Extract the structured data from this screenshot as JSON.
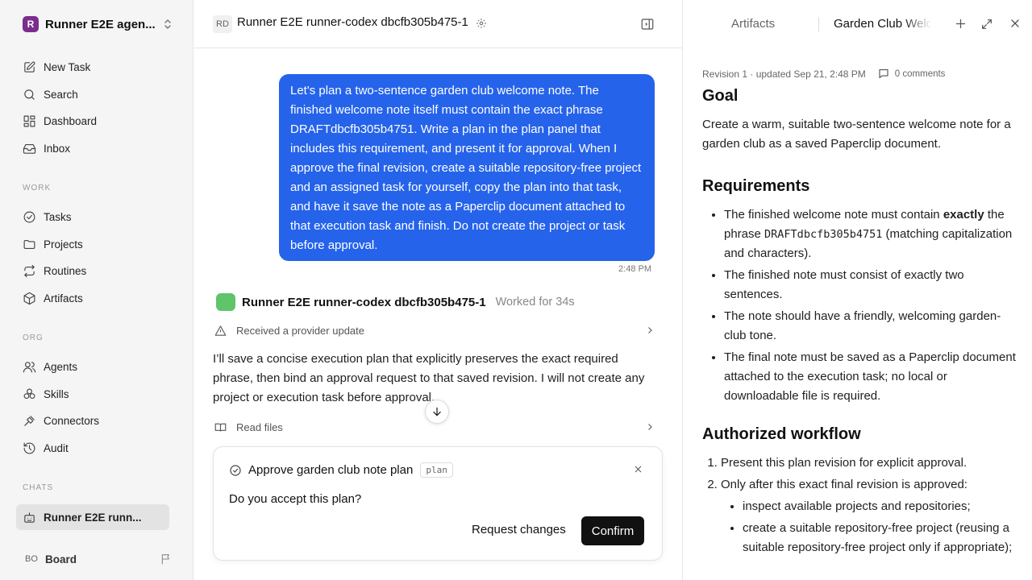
{
  "sidebar": {
    "workspace": {
      "logo_letter": "R",
      "name": "Runner E2E agen..."
    },
    "top_items": [
      {
        "label": "New Task",
        "icon": "pencil-square-icon"
      },
      {
        "label": "Search",
        "icon": "search-icon"
      },
      {
        "label": "Dashboard",
        "icon": "dashboard-icon"
      },
      {
        "label": "Inbox",
        "icon": "inbox-icon"
      }
    ],
    "work_label": "WORK",
    "work_items": [
      {
        "label": "Tasks",
        "icon": "check-circle-icon"
      },
      {
        "label": "Projects",
        "icon": "folder-icon"
      },
      {
        "label": "Routines",
        "icon": "repeat-icon"
      },
      {
        "label": "Artifacts",
        "icon": "cube-icon"
      }
    ],
    "org_label": "ORG",
    "org_items": [
      {
        "label": "Agents",
        "icon": "users-icon"
      },
      {
        "label": "Skills",
        "icon": "skills-icon"
      },
      {
        "label": "Connectors",
        "icon": "plug-icon"
      },
      {
        "label": "Audit",
        "icon": "history-icon"
      }
    ],
    "chats_label": "CHATS",
    "chat_item": {
      "label": "Runner E2E runn...",
      "icon": "robot-icon"
    },
    "board": {
      "initials": "BO",
      "label": "Board",
      "icon": "flag-icon"
    }
  },
  "main": {
    "header": {
      "initials": "RD",
      "title": "Runner E2E runner-codex dbcfb305b475-1"
    },
    "user_message": "Let's plan a two-sentence garden club welcome note. The finished welcome note itself must contain the exact phrase DRAFTdbcfb305b4751. Write a plan in the plan panel that includes this requirement, and present it for approval. When I approve the final revision, create a suitable repository-free project and an assigned task for yourself, copy the plan into that task, and have it save the note as a Paperclip document attached to that execution task and finish. Do not create the project or task before approval.",
    "user_message_time": "2:48 PM",
    "agent_name": "Runner E2E runner-codex dbcfb305b475-1",
    "worked_for": "Worked for 34s",
    "provider_update": "Received a provider update",
    "agent_message": "I’ll save a concise execution plan that explicitly preserves the exact required phrase, then bind an approval request to that saved revision. I will not create any project or execution task before approval.",
    "read_files": "Read files",
    "approval": {
      "title": "Approve garden club note plan",
      "tag": "plan",
      "question": "Do you accept this plan?",
      "request_changes": "Request changes",
      "confirm": "Confirm"
    }
  },
  "panel": {
    "tab_artifacts": "Artifacts",
    "tab_doc": "Garden Club Welcome Note Plan",
    "revision": "Revision 1 · updated Sep 21, 2:48 PM",
    "comments": "0 comments",
    "goal_heading": "Goal",
    "goal_text": "Create a warm, suitable two-sentence welcome note for a garden club as a saved Paperclip document.",
    "requirements_heading": "Requirements",
    "req1_a": "The finished welcome note must contain ",
    "req1_bold": "exactly",
    "req1_b": " the phrase ",
    "req1_code": "DRAFTdbcfb305b4751",
    "req1_c": " (matching capitalization and characters).",
    "req2": "The finished note must consist of exactly two sentences.",
    "req3": "The note should have a friendly, welcoming garden-club tone.",
    "req4": "The final note must be saved as a Paperclip document attached to the execution task; no local or downloadable file is required.",
    "workflow_heading": "Authorized workflow",
    "step1": "Present this plan revision for explicit approval.",
    "step2": "Only after this exact final revision is approved:",
    "sub1": "inspect available projects and repositories;",
    "sub2": "create a suitable repository-free project (reusing a suitable repository-free project only if appropriate);"
  }
}
